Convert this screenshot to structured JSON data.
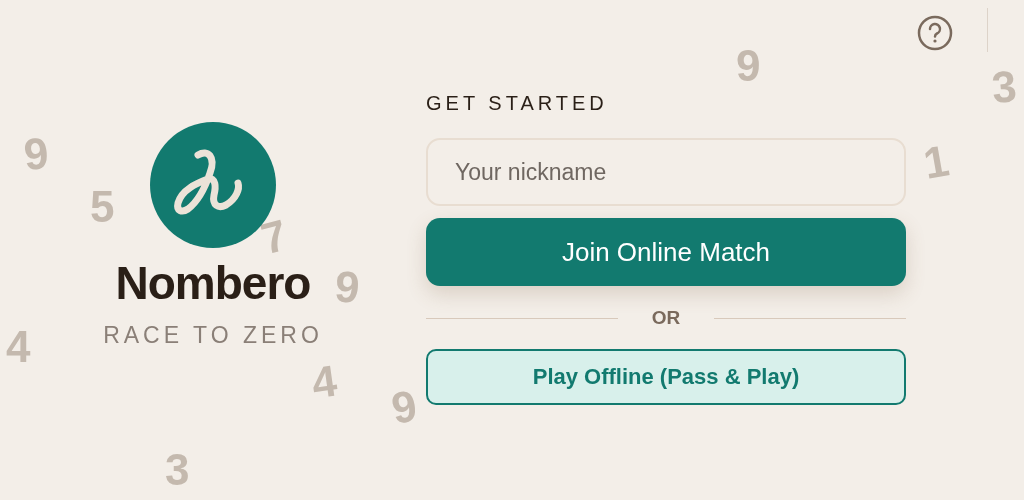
{
  "background_digits": [
    "9",
    "5",
    "7",
    "9",
    "4",
    "4",
    "9",
    "3",
    "9",
    "3",
    "1"
  ],
  "brand": {
    "name": "Nombero",
    "tagline": "RACE TO ZERO"
  },
  "form": {
    "heading": "GET STARTED",
    "nickname": {
      "placeholder": "Your nickname"
    },
    "primary_button": "Join Online Match",
    "separator": "OR",
    "secondary_button": "Play Offline (Pass & Play)"
  }
}
